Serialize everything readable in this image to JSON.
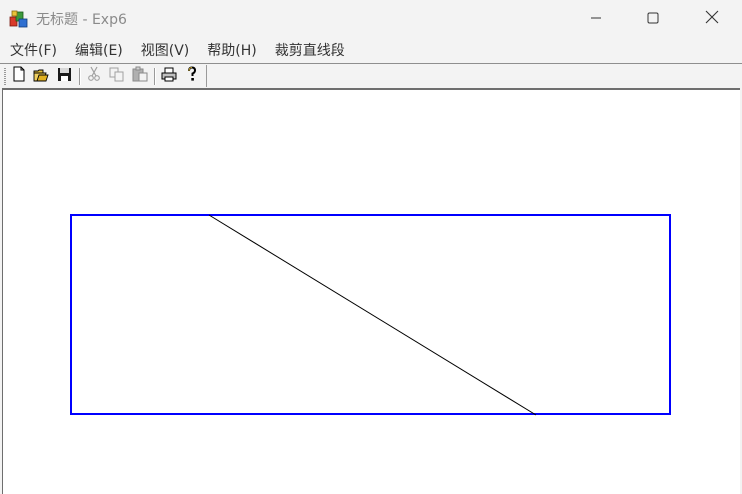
{
  "window": {
    "title": "无标题 - Exp6",
    "icon": "mfc-app-icon",
    "controls": {
      "minimize_icon": "minimize-icon",
      "maximize_icon": "maximize-icon",
      "close_icon": "close-icon"
    }
  },
  "menubar": {
    "items": [
      {
        "label": "文件(F)"
      },
      {
        "label": "编辑(E)"
      },
      {
        "label": "视图(V)"
      },
      {
        "label": "帮助(H)"
      },
      {
        "label": "裁剪直线段"
      }
    ]
  },
  "toolbar": {
    "buttons": [
      {
        "icon": "new-file-icon",
        "enabled": true
      },
      {
        "icon": "open-folder-icon",
        "enabled": true
      },
      {
        "icon": "save-icon",
        "enabled": true
      },
      {
        "icon": "cut-icon",
        "enabled": false
      },
      {
        "icon": "copy-icon",
        "enabled": false
      },
      {
        "icon": "paste-icon",
        "enabled": false
      },
      {
        "icon": "print-icon",
        "enabled": true
      },
      {
        "icon": "help-icon",
        "enabled": true
      }
    ]
  },
  "canvas": {
    "clip_window_color": "#0000ff",
    "line_color": "#000000",
    "background": "#ffffff"
  }
}
